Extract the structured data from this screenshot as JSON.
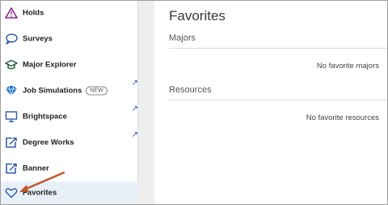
{
  "sidebar": {
    "items": [
      {
        "label": "Holds",
        "icon": "warning-triangle-icon"
      },
      {
        "label": "Surveys",
        "icon": "speech-bubble-icon"
      },
      {
        "label": "Major Explorer",
        "icon": "graduation-cap-icon"
      },
      {
        "label": "Job Simulations",
        "badge": "NEW",
        "icon": "simulation-diamond-icon",
        "external": true
      },
      {
        "label": "Brightspace",
        "icon": "monitor-icon",
        "external": true
      },
      {
        "label": "Degree Works",
        "icon": "external-edit-icon",
        "external": true
      },
      {
        "label": "Banner",
        "icon": "external-edit-icon",
        "external": true
      },
      {
        "label": "Favorites",
        "icon": "heart-icon",
        "selected": true
      }
    ],
    "external_glyph": "↗"
  },
  "main": {
    "title": "Favorites",
    "sections": [
      {
        "heading": "Majors",
        "empty_message": "No favorite majors"
      },
      {
        "heading": "Resources",
        "empty_message": "No favorite resources"
      }
    ]
  },
  "colors": {
    "accent": "#2b5aa7",
    "holds_icon": "#8a2a8f",
    "job_sim_icon": "#1a75c7",
    "annotation_arrow": "#c0572a"
  }
}
